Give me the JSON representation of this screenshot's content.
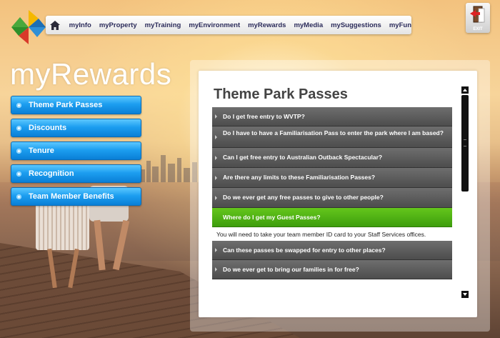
{
  "nav": {
    "home_icon": "home-icon",
    "items": [
      "myInfo",
      "myProperty",
      "myTraining",
      "myEnvironment",
      "myRewards",
      "myMedia",
      "mySuggestions",
      "myFun"
    ],
    "exit_label": "EXIT"
  },
  "page_title": "myRewards",
  "sidebar": {
    "items": [
      "Theme Park Passes",
      "Discounts",
      "Tenure",
      "Recognition",
      "Team Member Benefits"
    ]
  },
  "panel": {
    "title": "Theme Park Passes",
    "questions": [
      "Do I get free entry to WVTP?",
      "Do I have to have a Familiarisation Pass to enter the park where I am based?",
      "Can I get free entry to Australian Outback Spectacular?",
      "Are there any limits to these Familiarisation Passes?",
      "Do we ever get any free passes to give to other people?",
      "Where do I get my Guest Passes?",
      "Can these passes be swapped for entry to other places?",
      "Do we ever get to bring our families in for free?"
    ],
    "active_answer": "You will need to take your team member ID card to your Staff Services offices."
  },
  "colors": {
    "accent_blue": "#1c9ef0",
    "active_green": "#4fb215",
    "question_gray": "#5a5a5a"
  }
}
